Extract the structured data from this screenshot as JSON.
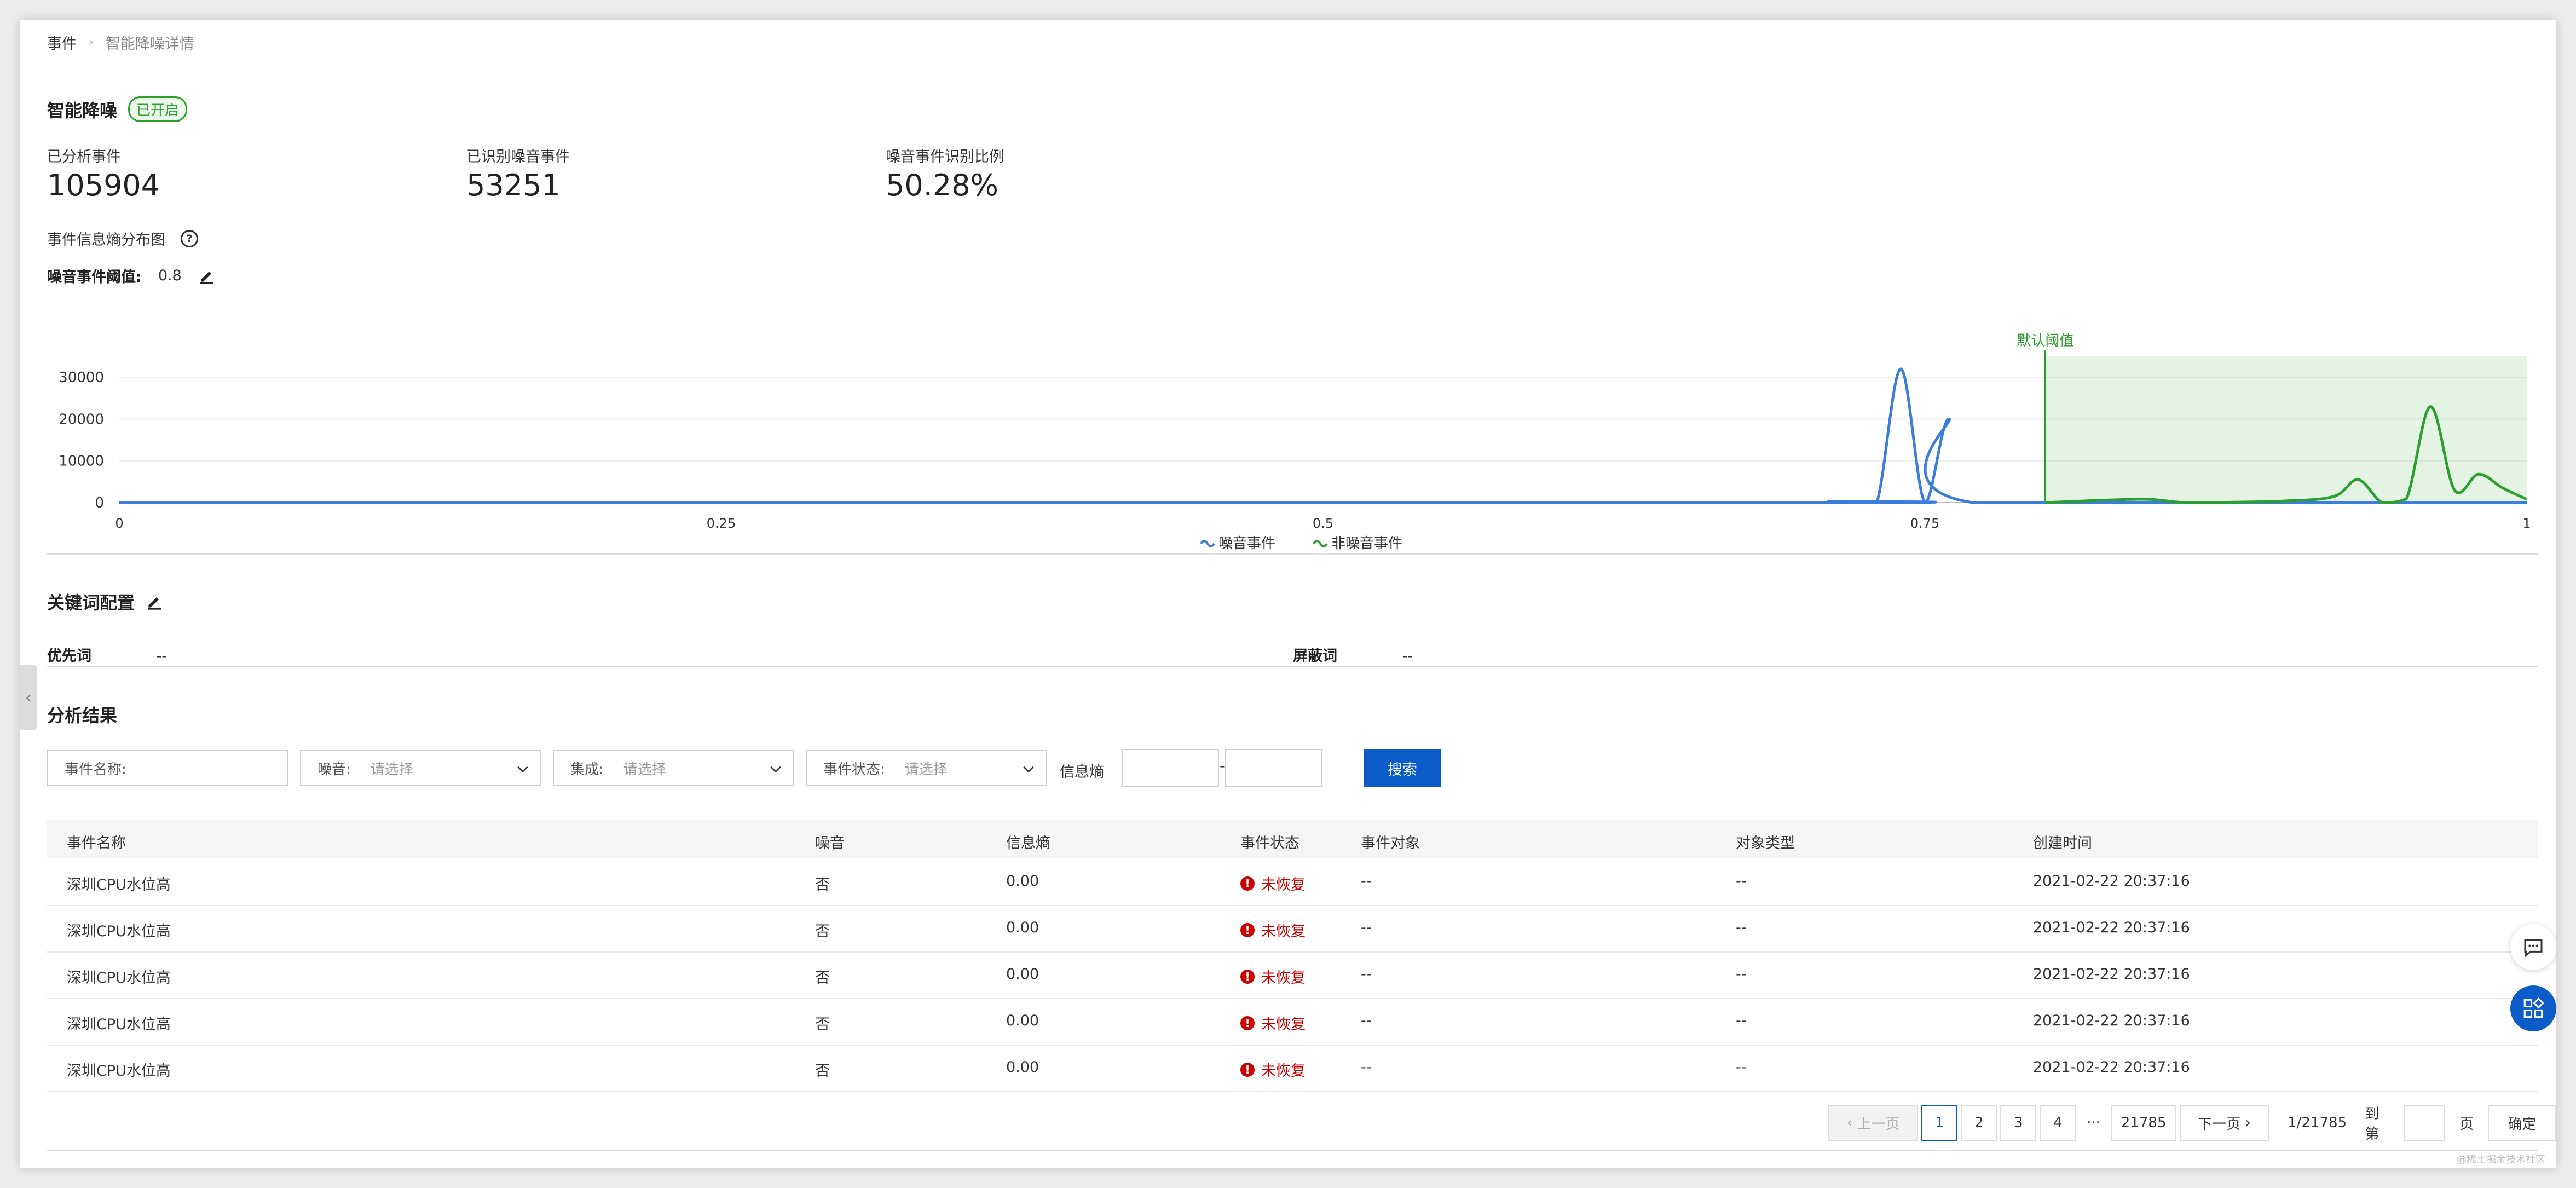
{
  "breadcrumb": {
    "root": "事件",
    "current": "智能降噪详情"
  },
  "section_noise": {
    "title": "智能降噪",
    "badge": "已开启"
  },
  "stats": [
    {
      "label": "已分析事件",
      "value": "105904"
    },
    {
      "label": "已识别噪音事件",
      "value": "53251"
    },
    {
      "label": "噪音事件识别比例",
      "value": "50.28%"
    }
  ],
  "entropy": {
    "title": "事件信息熵分布图",
    "help_icon": "question-circle-icon",
    "threshold_label": "噪音事件阈值:",
    "threshold_value": "0.8",
    "edit_icon": "pencil-icon"
  },
  "chart_data": {
    "type": "line",
    "x_ticks": [
      "0",
      "0.25",
      "0.5",
      "0.75",
      "1"
    ],
    "y_ticks": [
      "0",
      "10000",
      "20000",
      "30000"
    ],
    "xlim": [
      0,
      1
    ],
    "ylim": [
      0,
      35000
    ],
    "grid": true,
    "legend_position": "bottom-center",
    "annotation": {
      "label": "默认阈值",
      "x": 0.8
    },
    "series": [
      {
        "name": "噪音事件",
        "color": "#3b7ddd",
        "points": [
          [
            0,
            0
          ],
          [
            0.7,
            0
          ],
          [
            0.71,
            300
          ],
          [
            0.72,
            0
          ],
          [
            0.73,
            0
          ],
          [
            0.74,
            32000
          ],
          [
            0.75,
            0
          ],
          [
            0.76,
            20000
          ],
          [
            0.77,
            0
          ],
          [
            1,
            0
          ]
        ]
      },
      {
        "name": "非噪音事件",
        "color": "#2ca02c",
        "points": [
          [
            0.8,
            0
          ],
          [
            0.84,
            800
          ],
          [
            0.86,
            0
          ],
          [
            0.9,
            400
          ],
          [
            0.92,
            1500
          ],
          [
            0.93,
            5500
          ],
          [
            0.94,
            0
          ],
          [
            0.95,
            900
          ],
          [
            0.96,
            23000
          ],
          [
            0.97,
            3000
          ],
          [
            0.98,
            6800
          ],
          [
            0.99,
            3500
          ],
          [
            1,
            800
          ]
        ]
      }
    ]
  },
  "keywords": {
    "title": "关键词配置",
    "priority_label": "优先词",
    "priority_value": "--",
    "block_label": "屏蔽词",
    "block_value": "--"
  },
  "results": {
    "title": "分析结果",
    "filters": {
      "name_label": "事件名称:",
      "noise_label": "噪音:",
      "noise_placeholder": "请选择",
      "integration_label": "集成:",
      "integration_placeholder": "请选择",
      "status_label": "事件状态:",
      "status_placeholder": "请选择",
      "entropy_label": "信息熵",
      "range_sep": "-",
      "search_button": "搜索"
    },
    "columns": [
      "事件名称",
      "噪音",
      "信息熵",
      "事件状态",
      "事件对象",
      "对象类型",
      "创建时间"
    ],
    "rows": [
      [
        "深圳CPU水位高",
        "否",
        "0.00",
        "未恢复",
        "--",
        "--",
        "2021-02-22 20:37:16"
      ],
      [
        "深圳CPU水位高",
        "否",
        "0.00",
        "未恢复",
        "--",
        "--",
        "2021-02-22 20:37:16"
      ],
      [
        "深圳CPU水位高",
        "否",
        "0.00",
        "未恢复",
        "--",
        "--",
        "2021-02-22 20:37:16"
      ],
      [
        "深圳CPU水位高",
        "否",
        "0.00",
        "未恢复",
        "--",
        "--",
        "2021-02-22 20:37:16"
      ],
      [
        "深圳CPU水位高",
        "否",
        "0.00",
        "未恢复",
        "--",
        "--",
        "2021-02-22 20:37:16"
      ]
    ]
  },
  "pager": {
    "prev": "上一页",
    "pages": [
      "1",
      "2",
      "3",
      "4"
    ],
    "ellipsis": "···",
    "last": "21785",
    "next": "下一页",
    "summary": "1/21785",
    "goto_label": "到第",
    "page_unit": "页",
    "confirm": "确定"
  },
  "watermark": "@稀土掘金技术社区"
}
